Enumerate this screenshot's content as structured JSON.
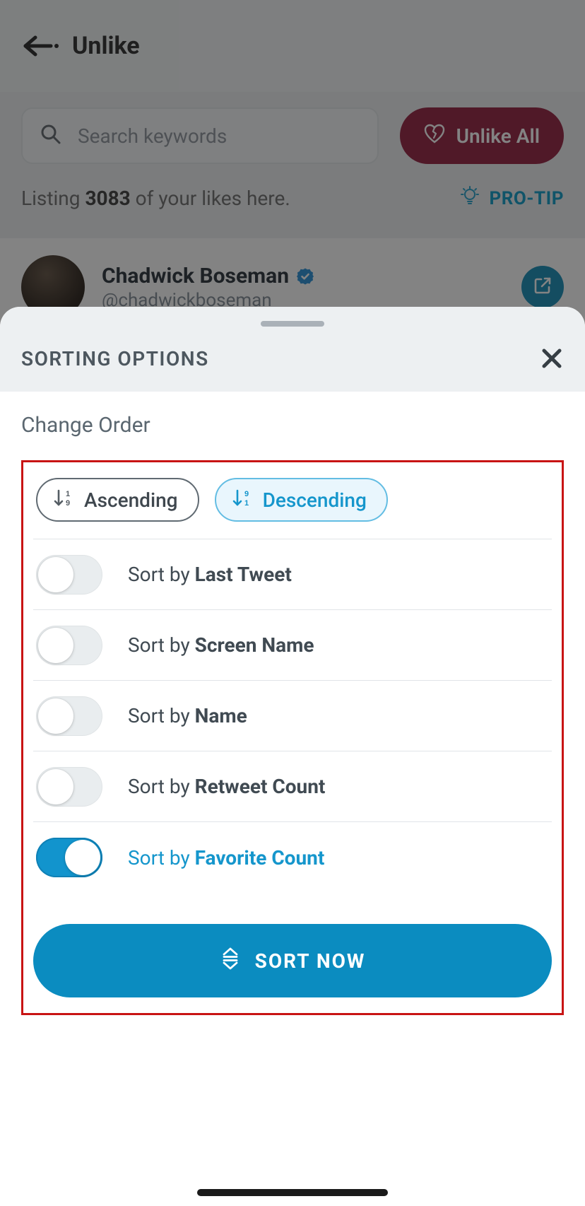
{
  "header": {
    "title": "Unlike"
  },
  "search": {
    "placeholder": "Search keywords"
  },
  "unlike_all": {
    "label": "Unlike All"
  },
  "listing": {
    "prefix": "Listing",
    "count": "3083",
    "suffix": "of your likes here."
  },
  "protip": {
    "label": "PRO-TIP"
  },
  "tweet": {
    "display_name": "Chadwick Boseman",
    "handle": "@chadwickboseman"
  },
  "sheet": {
    "title": "SORTING OPTIONS",
    "change_order": "Change Order",
    "pills": {
      "asc": "Ascending",
      "desc": "Descending"
    },
    "sort_prefix": "Sort by ",
    "options": [
      {
        "label": "Last Tweet",
        "on": false
      },
      {
        "label": "Screen Name",
        "on": false
      },
      {
        "label": "Name",
        "on": false
      },
      {
        "label": "Retweet Count",
        "on": false
      },
      {
        "label": "Favorite Count",
        "on": true
      }
    ],
    "sort_now": "SORT NOW"
  },
  "colors": {
    "accent": "#0b8cc0",
    "danger": "#8f1436"
  }
}
